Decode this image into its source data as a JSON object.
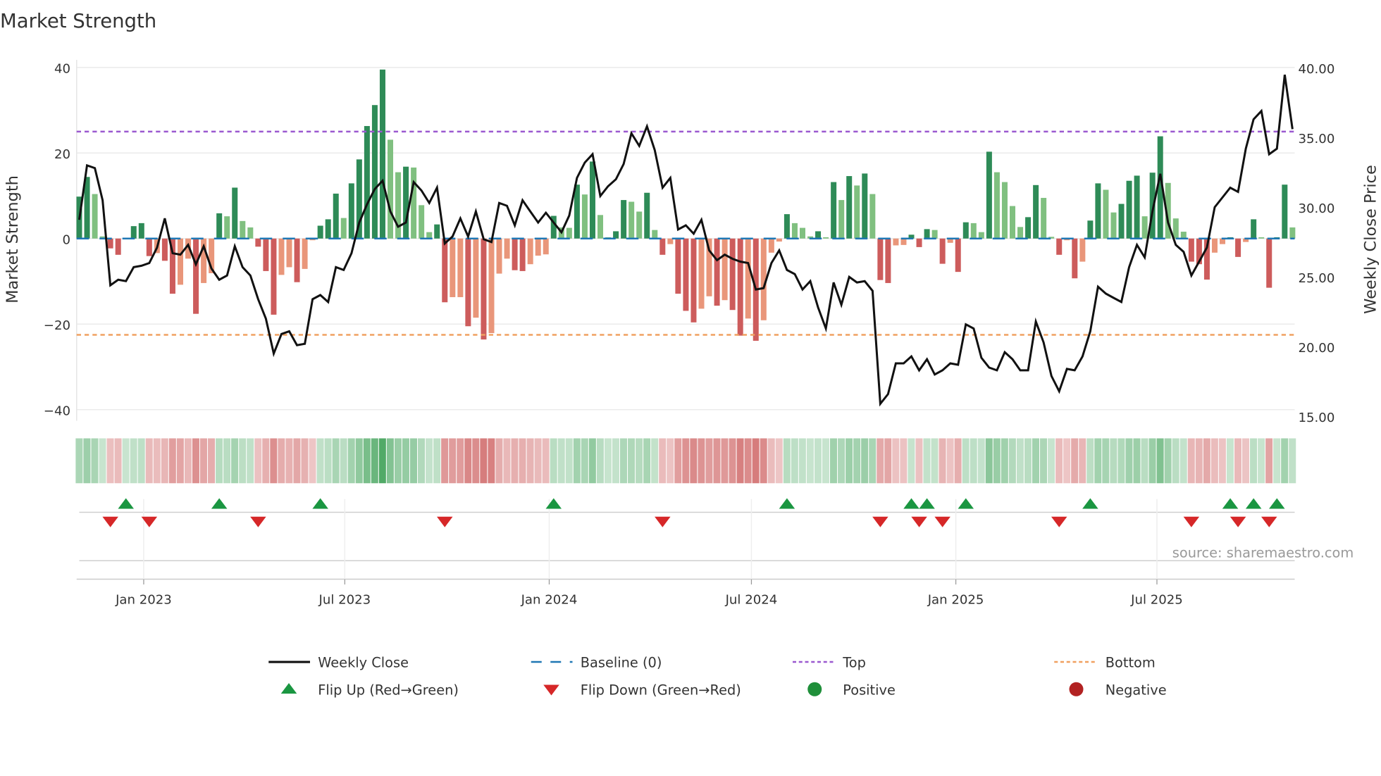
{
  "chart_data": {
    "type": "bar",
    "title": "Market Strength",
    "ylabel": "Market Strength",
    "y2label": "Weekly Close Price",
    "ylim": [
      -40,
      40
    ],
    "y2lim": [
      15,
      40
    ],
    "yticks": [
      "40",
      "20",
      "0",
      "−20",
      "−40"
    ],
    "ytick_values": [
      40,
      20,
      0,
      -20,
      -40
    ],
    "y2ticks": [
      "40.00",
      "35.00",
      "30.00",
      "25.00",
      "20.00",
      "15.00"
    ],
    "y2tick_values": [
      40,
      35,
      30,
      25,
      20,
      15
    ],
    "start_date": "2022-11-04",
    "frequency": "weekly",
    "xticks": [
      {
        "label": "Jan 2023",
        "date": "2023-01-01"
      },
      {
        "label": "Jul 2023",
        "date": "2023-07-01"
      },
      {
        "label": "Jan 2024",
        "date": "2024-01-01"
      },
      {
        "label": "Jul 2024",
        "date": "2024-07-01"
      },
      {
        "label": "Jan 2025",
        "date": "2025-01-01"
      },
      {
        "label": "Jul 2025",
        "date": "2025-07-01"
      }
    ],
    "top_level": 25,
    "bottom_level": -22.5,
    "baseline": 0,
    "strength": [
      9.8,
      14.4,
      10.4,
      0.5,
      -2.3,
      -3.8,
      0.2,
      2.9,
      3.6,
      -4.1,
      -3.4,
      -5.2,
      -12.9,
      -10.8,
      -4.7,
      -17.6,
      -10.4,
      -8.1,
      5.9,
      5.2,
      11.9,
      4.1,
      2.6,
      -1.9,
      -7.6,
      -17.8,
      -8.5,
      -6.7,
      -10.2,
      -7.1,
      -0.4,
      3.0,
      4.5,
      10.5,
      4.8,
      12.9,
      18.5,
      26.3,
      31.2,
      39.5,
      23.1,
      15.5,
      16.8,
      16.6,
      7.8,
      1.5,
      3.3,
      -14.9,
      -13.7,
      -13.7,
      -20.5,
      -18.5,
      -23.6,
      -22.1,
      -8.2,
      -4.7,
      -7.4,
      -7.6,
      -6.0,
      -4.0,
      -3.7,
      5.3,
      2.6,
      2.5,
      12.6,
      10.3,
      18.0,
      5.5,
      0.3,
      1.7,
      9.0,
      8.6,
      6.3,
      10.7,
      2.0,
      -3.8,
      -1.3,
      -12.9,
      -16.9,
      -19.6,
      -16.4,
      -13.5,
      -15.7,
      -14.4,
      -16.7,
      -22.7,
      -18.7,
      -23.9,
      -19.1,
      -3.3,
      -0.7,
      5.7,
      3.6,
      2.5,
      0.5,
      1.7,
      0.3,
      13.2,
      9.0,
      14.6,
      12.4,
      15.2,
      10.4,
      -9.7,
      -10.4,
      -1.6,
      -1.5,
      0.9,
      -2.0,
      2.2,
      2.0,
      -5.9,
      -1.0,
      -7.8,
      3.8,
      3.6,
      1.5,
      20.3,
      15.5,
      13.2,
      7.6,
      2.7,
      5.0,
      12.5,
      9.5,
      0.4,
      -3.8,
      -0.4,
      -9.3,
      -5.4,
      4.2,
      12.9,
      11.4,
      6.1,
      8.1,
      13.5,
      14.7,
      5.2,
      15.4,
      23.9,
      13.0,
      4.7,
      1.6,
      -5.4,
      -6.0,
      -9.6,
      -3.3,
      -1.3,
      0.3,
      -4.3,
      -0.8,
      4.5,
      0.3,
      -11.5,
      0.3,
      12.6,
      2.6
    ],
    "weekly_close": [
      29.1,
      33.0,
      32.8,
      30.5,
      24.4,
      24.8,
      24.7,
      25.7,
      25.8,
      26.0,
      27.1,
      29.2,
      26.7,
      26.6,
      27.3,
      25.9,
      27.2,
      25.6,
      24.8,
      25.1,
      27.2,
      25.7,
      25.1,
      23.4,
      22.0,
      19.5,
      20.9,
      21.1,
      20.1,
      20.2,
      23.4,
      23.7,
      23.2,
      25.7,
      25.5,
      26.7,
      28.9,
      30.2,
      31.3,
      31.9,
      29.7,
      28.6,
      28.9,
      31.8,
      31.2,
      30.3,
      31.4,
      27.4,
      27.9,
      29.2,
      27.9,
      29.7,
      27.7,
      27.5,
      30.3,
      30.1,
      28.7,
      30.5,
      29.7,
      28.9,
      29.6,
      28.9,
      28.2,
      29.4,
      32.1,
      33.2,
      33.8,
      30.8,
      31.5,
      32.0,
      33.1,
      35.3,
      34.4,
      35.8,
      34.1,
      31.4,
      32.1,
      28.4,
      28.7,
      28.1,
      29.1,
      26.9,
      26.2,
      26.6,
      26.3,
      26.1,
      26.0,
      24.1,
      24.2,
      26.0,
      26.9,
      25.5,
      25.2,
      24.1,
      24.7,
      22.8,
      21.3,
      24.6,
      23.0,
      25.0,
      24.6,
      24.7,
      24.0,
      15.9,
      16.6,
      18.8,
      18.8,
      19.3,
      18.3,
      19.1,
      18.0,
      18.3,
      18.8,
      18.7,
      21.6,
      21.3,
      19.2,
      18.5,
      18.3,
      19.6,
      19.1,
      18.3,
      18.3,
      21.8,
      20.3,
      17.9,
      16.8,
      18.4,
      18.3,
      19.3,
      21.1,
      24.3,
      23.8,
      23.5,
      23.2,
      25.7,
      27.3,
      26.4,
      29.7,
      32.4,
      28.9,
      27.3,
      26.8,
      25.1,
      26.1,
      27.1,
      30.0,
      30.7,
      31.4,
      31.1,
      34.2,
      36.3,
      36.9,
      33.8,
      34.2,
      39.5,
      35.6
    ],
    "legend": [
      {
        "label": "Weekly Close",
        "symbol": "line"
      },
      {
        "label": "Baseline (0)",
        "symbol": "dashed"
      },
      {
        "label": "Top",
        "symbol": "dotted-purple"
      },
      {
        "label": "Bottom",
        "symbol": "dotted-orange"
      },
      {
        "label": "Flip Up (Red→Green)",
        "symbol": "triangle-up"
      },
      {
        "label": "Flip Down (Green→Red)",
        "symbol": "triangle-down"
      },
      {
        "label": "Positive",
        "symbol": "circle-green"
      },
      {
        "label": "Negative",
        "symbol": "circle-red"
      }
    ],
    "legend_placement": "bottom",
    "source": "source: sharemaestro.com",
    "colors": {
      "pos_dark": "#2e8b57",
      "pos_light": "#80c080",
      "neg_dark": "#cd5c5c",
      "neg_light": "#e9967a",
      "line": "#111111",
      "baseline": "#1f77b4",
      "top": "#9b59d0",
      "bottom": "#f0a060",
      "flip_up": "#1a9641",
      "flip_down": "#d62728",
      "positive": "#1f8f3a",
      "negative": "#b22222"
    }
  }
}
